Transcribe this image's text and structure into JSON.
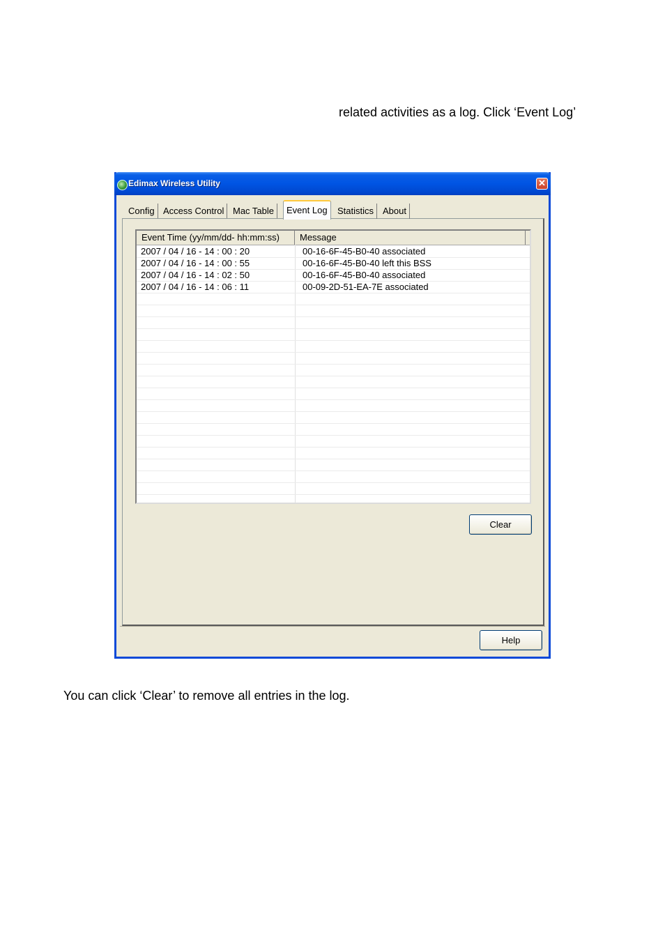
{
  "document": {
    "intro_text": "related activities as a log. Click ‘Event Log’",
    "outro_text": "You can click ‘Clear’ to remove all entries in the log."
  },
  "window": {
    "title": "Edimax Wireless Utility",
    "close_glyph": "✕",
    "app_icon": "edimax-app-icon"
  },
  "tabs": [
    {
      "label": "Config",
      "active": false
    },
    {
      "label": "Access Control",
      "active": false
    },
    {
      "label": "Mac Table",
      "active": false
    },
    {
      "label": "Event Log",
      "active": true
    },
    {
      "label": "Statistics",
      "active": false
    },
    {
      "label": "About",
      "active": false
    }
  ],
  "event_log": {
    "columns": [
      "Event Time (yy/mm/dd- hh:mm:ss)",
      "Message"
    ],
    "rows": [
      {
        "time": "2007 / 04 / 16 - 14 : 00 : 20",
        "message": "00-16-6F-45-B0-40 associated"
      },
      {
        "time": "2007 / 04 / 16 - 14 : 00 : 55",
        "message": "00-16-6F-45-B0-40 left this BSS"
      },
      {
        "time": "2007 / 04 / 16 - 14 : 02 : 50",
        "message": "00-16-6F-45-B0-40 associated"
      },
      {
        "time": "2007 / 04 / 16 - 14 : 06 : 11",
        "message": "00-09-2D-51-EA-7E associated"
      }
    ]
  },
  "buttons": {
    "clear_label": "Clear",
    "help_label": "Help"
  }
}
